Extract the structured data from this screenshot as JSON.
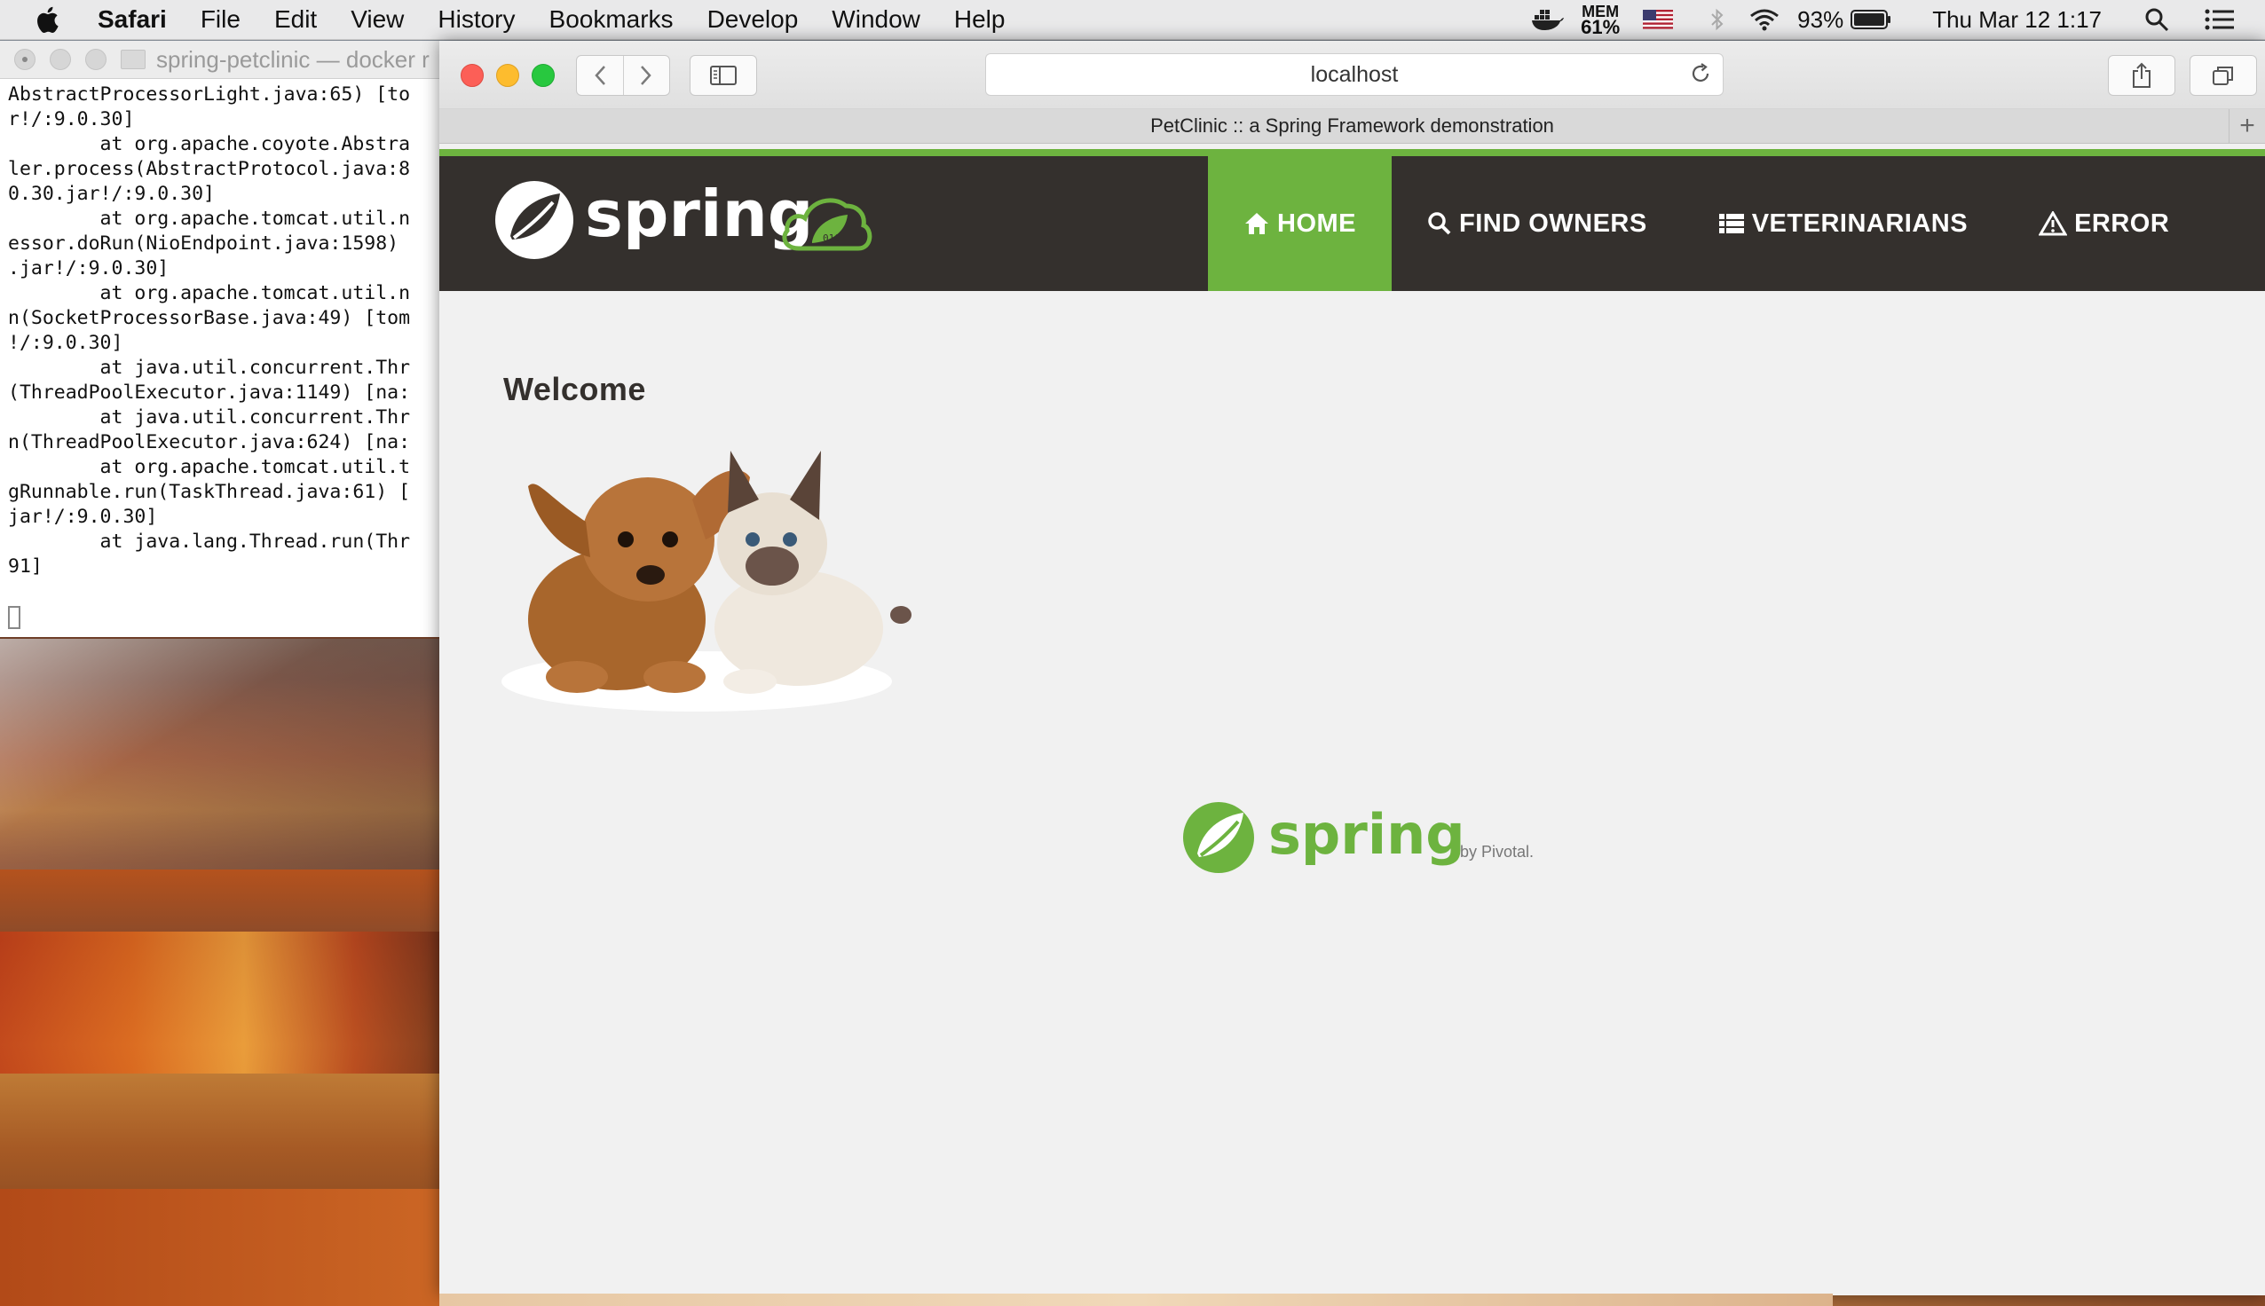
{
  "menubar": {
    "app_name": "Safari",
    "items": [
      "File",
      "Edit",
      "View",
      "History",
      "Bookmarks",
      "Develop",
      "Window",
      "Help"
    ],
    "mem_label": "MEM",
    "mem_value": "61%",
    "battery": "93%",
    "clock": "Thu Mar 12  1:17"
  },
  "terminal": {
    "title": "spring-petclinic — docker r",
    "lines": "AbstractProcessorLight.java:65) [to\nr!/:9.0.30]\n        at org.apache.coyote.Abstra\nler.process(AbstractProtocol.java:8\n0.30.jar!/:9.0.30]\n        at org.apache.tomcat.util.n\nessor.doRun(NioEndpoint.java:1598)\n.jar!/:9.0.30]\n        at org.apache.tomcat.util.n\nn(SocketProcessorBase.java:49) [tom\n!/:9.0.30]\n        at java.util.concurrent.Thr\n(ThreadPoolExecutor.java:1149) [na:\n        at java.util.concurrent.Thr\nn(ThreadPoolExecutor.java:624) [na:\n        at org.apache.tomcat.util.t\ngRunnable.run(TaskThread.java:61) [\njar!/:9.0.30]\n        at java.lang.Thread.run(Thr\n91]"
  },
  "browser": {
    "url": "localhost",
    "tab_title": "PetClinic :: a Spring Framework demonstration",
    "new_tab_glyph": "+"
  },
  "petclinic": {
    "brand": "spring",
    "nav": [
      {
        "label": "HOME",
        "icon": "home-icon",
        "active": true
      },
      {
        "label": "FIND OWNERS",
        "icon": "search-icon",
        "active": false
      },
      {
        "label": "VETERINARIANS",
        "icon": "list-icon",
        "active": false
      },
      {
        "label": "ERROR",
        "icon": "warning-icon",
        "active": false
      }
    ],
    "heading": "Welcome",
    "footer_brand": "spring",
    "footer_by": "by Pivotal."
  },
  "colors": {
    "spring_green": "#6db33f",
    "navbar_bg": "#34302d",
    "page_bg": "#f1f1f1"
  }
}
